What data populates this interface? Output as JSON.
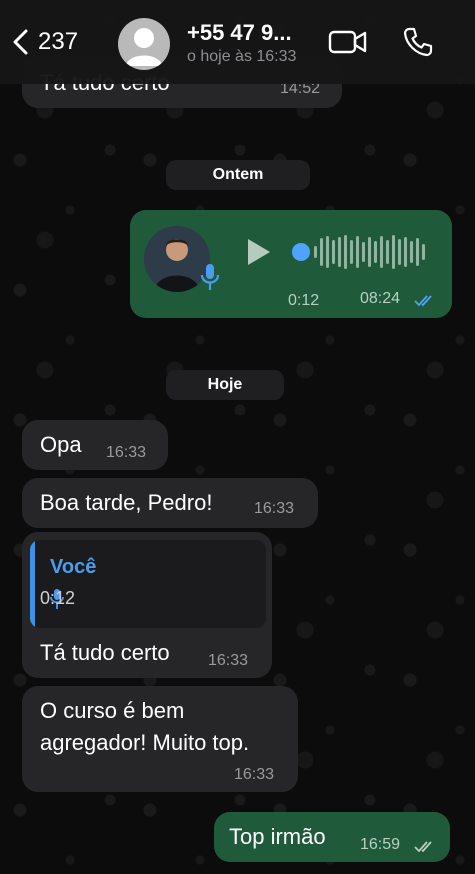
{
  "header": {
    "back_count": "237",
    "contact_name": "+55 47 9...",
    "status": "o hoje às 16:33"
  },
  "messages": [
    {
      "text": "Tá tudo certo",
      "time": "14:52"
    },
    {
      "day": "Ontem"
    },
    {
      "voice_duration": "0:12",
      "time": "08:24"
    },
    {
      "day": "Hoje"
    },
    {
      "text": "Opa",
      "time": "16:33"
    },
    {
      "text": "Boa tarde, Pedro!",
      "time": "16:33"
    },
    {
      "quote_author": "Você",
      "quote_duration": "0:12",
      "text": "Tá tudo certo",
      "time": "16:33"
    },
    {
      "text_line1": "O curso é bem",
      "text_line2": "agregador! Muito top.",
      "time": "16:33"
    },
    {
      "text": "Top irmão",
      "time": "16:59"
    }
  ],
  "colors": {
    "outgoing": "#1f5b3b",
    "incoming": "#262628",
    "quote_accent": "#3d91e6",
    "read_ticks": "#4fa3ff"
  },
  "icons": [
    "chevron-left-icon",
    "avatar-placeholder-icon",
    "video-camera-icon",
    "phone-icon",
    "play-icon",
    "microphone-icon",
    "double-check-icon"
  ]
}
